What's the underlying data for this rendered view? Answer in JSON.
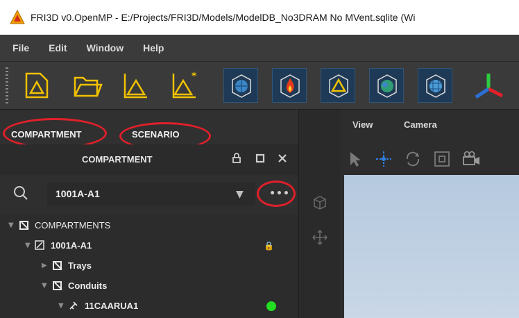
{
  "window": {
    "title": "FRI3D v0.OpenMP - E:/Projects/FRI3D/Models/ModelDB_No3DRAM No MVent.sqlite (Wi"
  },
  "menu": [
    "File",
    "Edit",
    "Window",
    "Help"
  ],
  "toolbar": {
    "buttons": [
      "new-file-icon",
      "open-folder-icon",
      "new-triangle-icon",
      "star-triangle-icon",
      "cube-sphere-icon",
      "cube-fire-icon",
      "cube-triangle-icon",
      "cube-globe-icon",
      "cube-mesh-icon",
      "axes-icon"
    ]
  },
  "left_panel": {
    "tabs": [
      "COMPARTMENT",
      "SCENARIO"
    ],
    "header": "COMPARTMENT",
    "search": {
      "value": "1001A-A1",
      "more_label": "•••"
    },
    "tree": [
      {
        "label": "COMPARTMENTS",
        "level": 0
      },
      {
        "label": "1001A-A1",
        "level": 1
      },
      {
        "label": "Trays",
        "level": 2
      },
      {
        "label": "Conduits",
        "level": 2
      },
      {
        "label": "11CAARUA1",
        "level": 3
      }
    ]
  },
  "view_panel": {
    "menu": [
      "View",
      "Camera"
    ]
  },
  "colors": {
    "highlight": "#e0202a",
    "status_green": "#22dd22",
    "toolbar_accent": "#f2c200"
  }
}
